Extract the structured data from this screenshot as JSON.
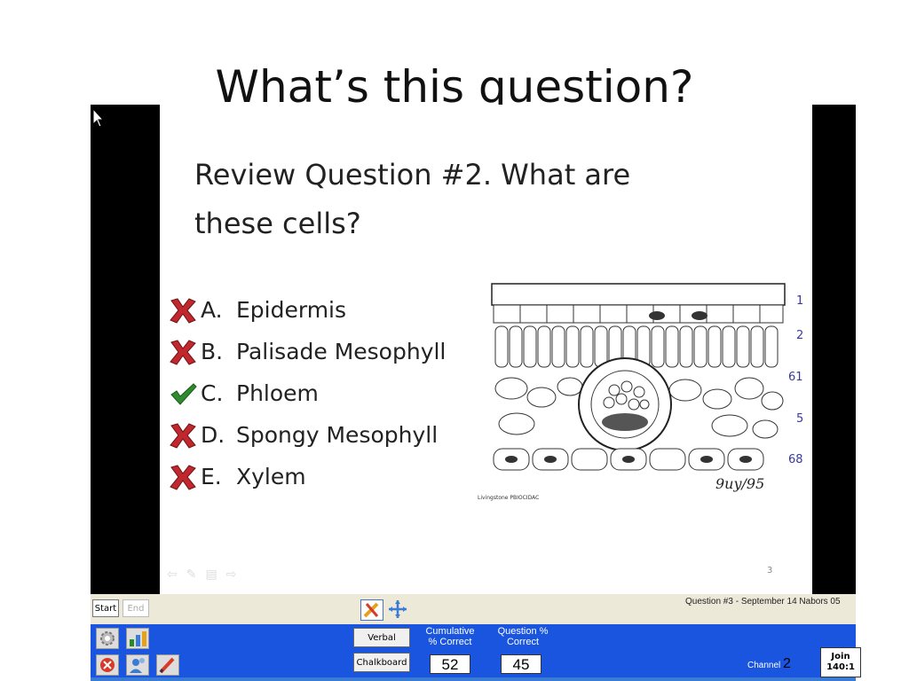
{
  "heading": "What’s this question?",
  "slide": {
    "question": "Review Question #2. What are these cells?",
    "answers": [
      {
        "letter": "A.",
        "text": "Epidermis",
        "status": "wrong"
      },
      {
        "letter": "B.",
        "text": "Palisade Mesophyll",
        "status": "wrong"
      },
      {
        "letter": "C.",
        "text": "Phloem",
        "status": "correct"
      },
      {
        "letter": "D.",
        "text": "Spongy Mesophyll",
        "status": "wrong"
      },
      {
        "letter": "E.",
        "text": "Xylem",
        "status": "wrong"
      }
    ],
    "figure_labels": [
      "1",
      "2",
      "61",
      "5",
      "68"
    ],
    "signature": "9uy/95",
    "credit": "Livingstone PBIOCIDAC",
    "page_number": "3"
  },
  "toolbar": {
    "start_label": "Start",
    "end_label": "End",
    "question_info": "Question #3 - September 14 Nabors 05",
    "verbal_label": "Verbal",
    "chalkboard_label": "Chalkboard",
    "cumulative_label": "Cumulative % Correct",
    "cumulative_value": "52",
    "question_label": "Question % Correct",
    "question_value": "45",
    "channel_label": "Channel",
    "channel_value": "2",
    "join_label": "Join",
    "join_time": "140:1"
  },
  "colors": {
    "toolbar_blue": "#1a55e0",
    "toolbar_grey": "#ece9d8",
    "wrong_mark": "#c0282d",
    "correct_mark": "#2e8b2e"
  }
}
